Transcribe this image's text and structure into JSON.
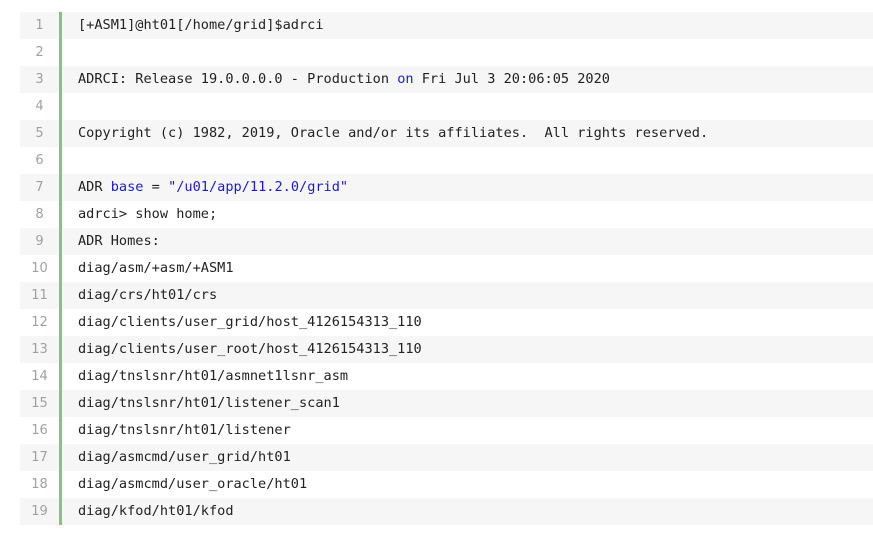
{
  "lines": [
    {
      "num": "1",
      "text": "[+ASM1]@ht01[/home/grid]$adrci"
    },
    {
      "num": "2",
      "text": ""
    },
    {
      "num": "3",
      "pre": "ADRCI: Release 19.0.0.0.0 - Production ",
      "kw": "on",
      "post": " Fri Jul 3 20:06:05 2020"
    },
    {
      "num": "4",
      "text": ""
    },
    {
      "num": "5",
      "text": "Copyright (c) 1982, 2019, Oracle and/or its affiliates.  All rights reserved."
    },
    {
      "num": "6",
      "text": ""
    },
    {
      "num": "7",
      "pre": "ADR ",
      "kw": "base",
      "mid": " = ",
      "str": "\"/u01/app/11.2.0/grid\""
    },
    {
      "num": "8",
      "text": "adrci> show home;"
    },
    {
      "num": "9",
      "text": "ADR Homes:"
    },
    {
      "num": "10",
      "text": "diag/asm/+asm/+ASM1"
    },
    {
      "num": "11",
      "text": "diag/crs/ht01/crs"
    },
    {
      "num": "12",
      "text": "diag/clients/user_grid/host_4126154313_110"
    },
    {
      "num": "13",
      "text": "diag/clients/user_root/host_4126154313_110"
    },
    {
      "num": "14",
      "text": "diag/tnslsnr/ht01/asmnet1lsnr_asm"
    },
    {
      "num": "15",
      "text": "diag/tnslsnr/ht01/listener_scan1"
    },
    {
      "num": "16",
      "text": "diag/tnslsnr/ht01/listener"
    },
    {
      "num": "17",
      "text": "diag/asmcmd/user_grid/ht01"
    },
    {
      "num": "18",
      "text": "diag/asmcmd/user_oracle/ht01"
    },
    {
      "num": "19",
      "text": "diag/kfod/ht01/kfod"
    }
  ],
  "colors": {
    "keyword": "#1a1ad6",
    "gutter_bar": "#7fc77f",
    "stripe": "#f6f6f6"
  }
}
